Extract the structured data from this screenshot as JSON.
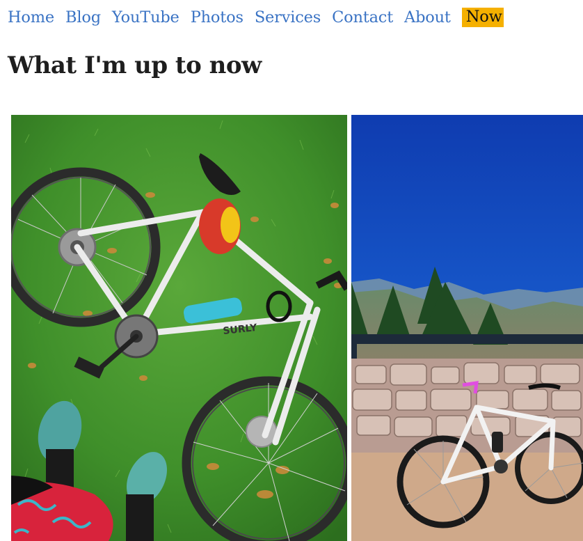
{
  "nav": {
    "items": [
      {
        "label": "Home"
      },
      {
        "label": "Blog"
      },
      {
        "label": "YouTube"
      },
      {
        "label": "Photos"
      },
      {
        "label": "Services"
      },
      {
        "label": "Contact"
      },
      {
        "label": "About"
      },
      {
        "label": "Now",
        "active": true
      }
    ],
    "link_color": "#3a73c4",
    "active_bg": "#f5b000"
  },
  "page": {
    "title": "What I'm up to now"
  },
  "photos": [
    {
      "subject": "white bicycle lying on grass with feet in teal shoes",
      "brand_text": "SURLY"
    },
    {
      "subject": "white bicycle on a mountain overlook under blue sky"
    }
  ]
}
